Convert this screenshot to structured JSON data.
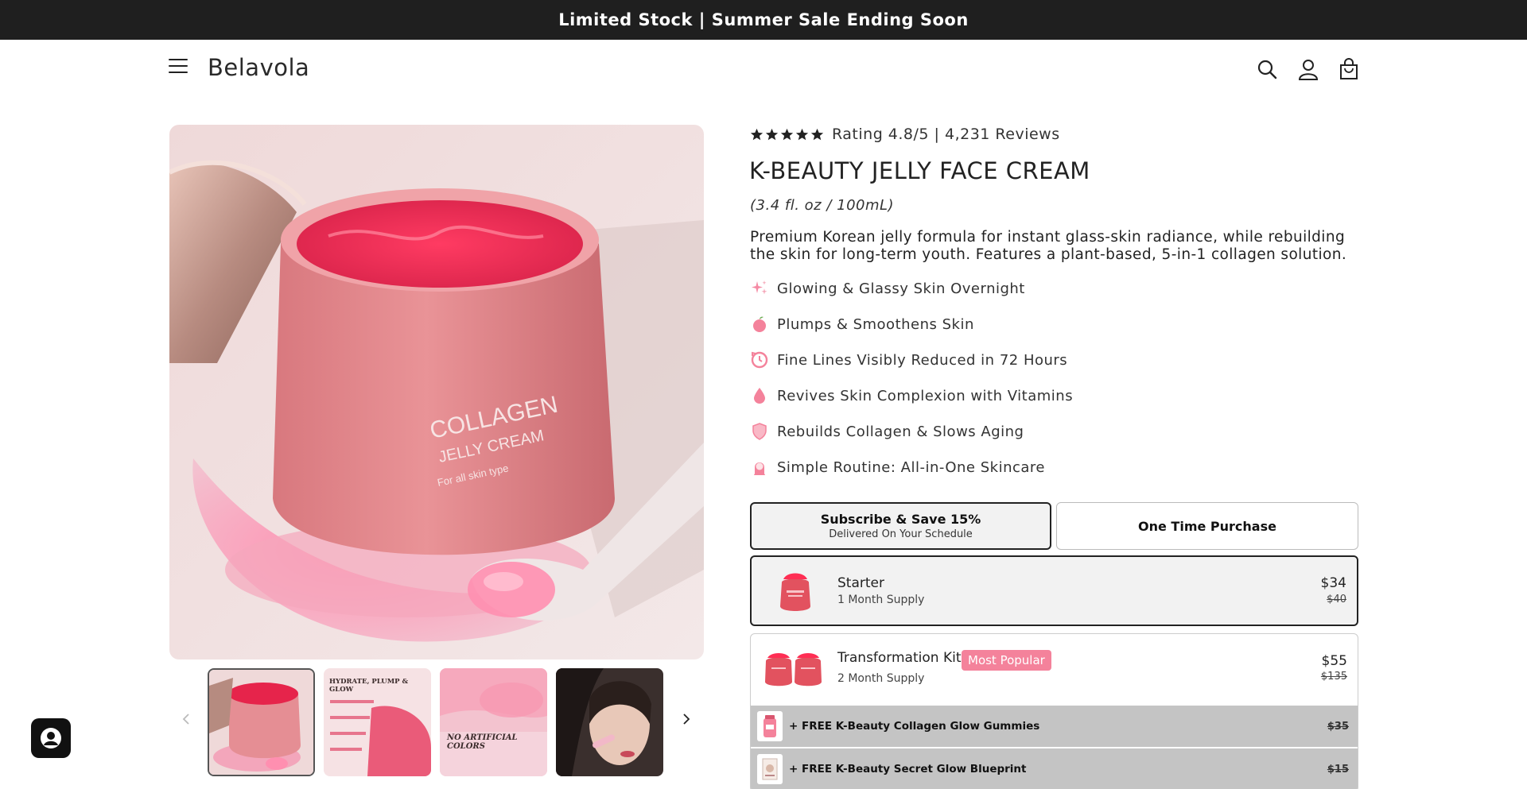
{
  "announcement": "Limited Stock | Summer Sale Ending Soon",
  "header": {
    "logo": "Belavola",
    "icons": [
      "hamburger-menu-icon",
      "search-icon",
      "account-icon",
      "cart-bag-icon"
    ]
  },
  "gallery": {
    "main_jar_label_line1": "COLLAGEN",
    "main_jar_label_line2": "JELLY CREAM",
    "main_jar_label_line3": "For all skin type",
    "thumbnails": [
      {
        "name": "thumb-jar"
      },
      {
        "name": "thumb-hydrate",
        "caption": "HYDRATE, PLUMP & GLOW"
      },
      {
        "name": "thumb-no-artificial",
        "caption_line1": "NO ARTIFICIAL",
        "caption_line2": "COLORS"
      },
      {
        "name": "thumb-model"
      }
    ]
  },
  "product": {
    "rating_text": "Rating 4.8/5 | 4,231 Reviews",
    "rating_stars": 5,
    "title": "K-BEAUTY JELLY FACE CREAM",
    "size": "(3.4 fl. oz / 100mL)",
    "description": "Premium Korean jelly formula for instant glass-skin radiance, while rebuilding the skin for long-term youth. Features a plant-based, 5-in-1 collagen solution.",
    "benefits": [
      {
        "icon": "sparkles-icon",
        "text": "Glowing & Glassy Skin Overnight"
      },
      {
        "icon": "peach-icon",
        "text": "Plumps & Smoothens Skin"
      },
      {
        "icon": "clock-reverse-icon",
        "text": "Fine Lines Visibly Reduced in 72 Hours"
      },
      {
        "icon": "droplet-icon",
        "text": "Revives Skin Complexion with Vitamins"
      },
      {
        "icon": "shield-icon",
        "text": "Rebuilds Collagen & Slows Aging"
      },
      {
        "icon": "woman-icon",
        "text": "Simple Routine: All-in-One Skincare"
      }
    ]
  },
  "purchase": {
    "subscribe_title": "Subscribe & Save 15%",
    "subscribe_sub": "Delivered On Your Schedule",
    "one_time": "One Time Purchase"
  },
  "bundles": {
    "starter": {
      "name": "Starter",
      "sub": "1 Month Supply",
      "price": "$34",
      "old_price": "$40"
    },
    "kit": {
      "name": "Transformation Kit",
      "badge": "Most Popular",
      "sub": "2 Month Supply",
      "price": "$55",
      "old_price": "$135",
      "freebies": [
        {
          "text": "+ FREE K-Beauty Collagen Glow Gummies",
          "price": "$35"
        },
        {
          "text": "+ FREE K-Beauty Secret Glow Blueprint",
          "price": "$15"
        }
      ]
    }
  },
  "colors": {
    "accent_pink": "#f4829b",
    "dark": "#1f1f1f",
    "selected_bg": "#f2f2f2"
  }
}
